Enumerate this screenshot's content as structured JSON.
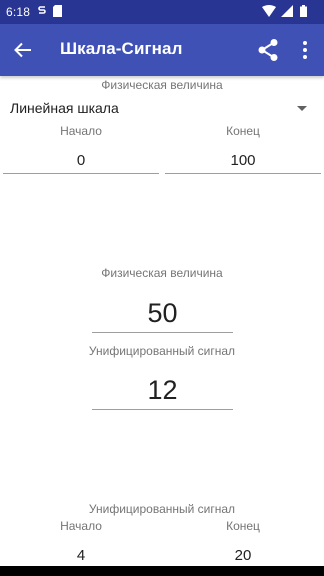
{
  "status_bar": {
    "time": "6:18",
    "icons": [
      "wifi-icon",
      "signal-icon",
      "battery-icon"
    ],
    "color": "#283593"
  },
  "app_bar": {
    "title": "Шкала-Сигнал",
    "back_icon": "arrow-back-icon",
    "share_icon": "share-icon",
    "menu_icon": "more-vert-icon",
    "color": "#3f51b5"
  },
  "scale": {
    "caption": "Физическая величина",
    "type_selected": "Линейная шкала",
    "start_label": "Начало",
    "end_label": "Конец",
    "start_value": "0",
    "end_value": "100"
  },
  "conversion": {
    "physical_label": "Физическая величина",
    "physical_value": "50",
    "signal_label": "Унифицированный сигнал",
    "signal_value": "12"
  },
  "signal_range": {
    "caption": "Унифицированный сигнал",
    "start_label": "Начало",
    "end_label": "Конец",
    "start_value": "4",
    "end_value": "20"
  }
}
